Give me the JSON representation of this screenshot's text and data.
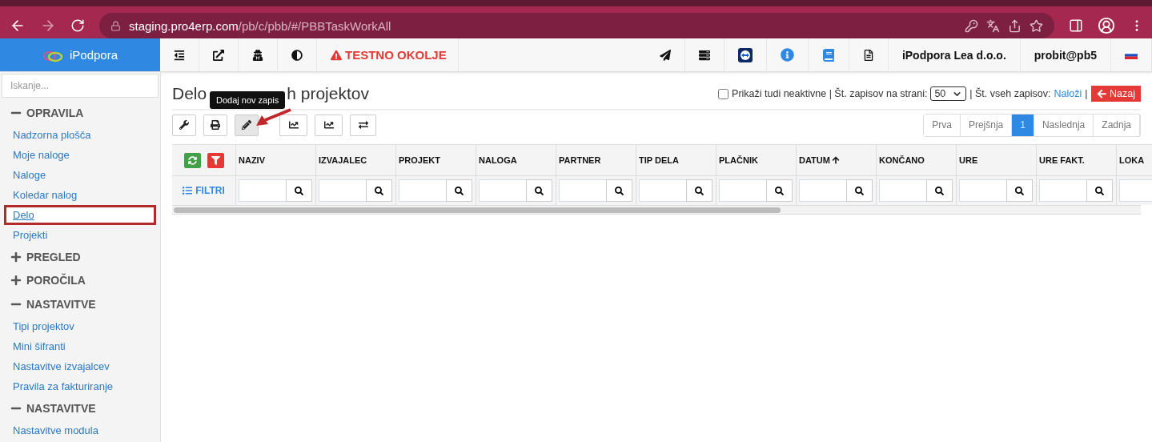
{
  "browser": {
    "url_host": "staging.pro4erp.com",
    "url_path": "/pb/c/pbb/#/PBBTaskWorkAll"
  },
  "header": {
    "brand": "iPodpora",
    "warning": "TESTNO OKOLJE",
    "company": "iPodpora Lea d.o.o.",
    "user": "probit@pb5"
  },
  "sidebar": {
    "search": {
      "placeholder": "Iskanje..."
    },
    "sections": [
      {
        "title": "OPRAVILA",
        "expanded": true,
        "items": [
          {
            "label": "Nadzorna plošča",
            "selected": false
          },
          {
            "label": "Moje naloge",
            "selected": false
          },
          {
            "label": "Naloge",
            "selected": false
          },
          {
            "label": "Koledar nalog",
            "selected": false
          },
          {
            "label": "Delo",
            "selected": true
          },
          {
            "label": "Projekti",
            "selected": false
          }
        ]
      },
      {
        "title": "PREGLED",
        "expanded": false
      },
      {
        "title": "POROČILA",
        "expanded": false
      },
      {
        "title": "NASTAVITVE",
        "expanded": true,
        "items": [
          {
            "label": "Tipi projektov",
            "selected": false
          },
          {
            "label": "Mini šifranti",
            "selected": false
          },
          {
            "label": "Nastavitve izvajalcev",
            "selected": false
          },
          {
            "label": "Pravila za fakturiranje",
            "selected": false
          }
        ]
      },
      {
        "title": "NASTAVITVE",
        "expanded": true,
        "items": [
          {
            "label": "Nastavitve modula",
            "selected": false
          }
        ]
      }
    ]
  },
  "page": {
    "title_parts": [
      "Delo",
      "h projektov"
    ],
    "tooltip": "Dodaj nov zapis",
    "options": {
      "show_inactive_label": "Prikaži tudi neaktivne | Št. zapisov na strani:",
      "show_inactive": false,
      "page_size": "50",
      "total_label": "| Št. vseh zapisov:",
      "load_link": "Naloži",
      "separator": "|",
      "back_button": "Nazaj"
    },
    "tools": [
      {
        "kind": "settings",
        "pressed": false
      },
      {
        "kind": "print",
        "pressed": false
      },
      {
        "kind": "edit",
        "pressed": true
      },
      {
        "kind": "chart",
        "pressed": false
      },
      {
        "kind": "chart",
        "pressed": false
      },
      {
        "kind": "swap",
        "pressed": false
      }
    ],
    "pagination": [
      {
        "label": "Prva",
        "selected": false
      },
      {
        "label": "Prejšnja",
        "selected": false
      },
      {
        "label": "1",
        "selected": true
      },
      {
        "label": "Naslednja",
        "selected": false
      },
      {
        "label": "Zadnja",
        "selected": false
      }
    ],
    "filters_label": "FILTRI",
    "columns": [
      {
        "label": "NAZIV",
        "sorted": false
      },
      {
        "label": "IZVAJALEC",
        "sorted": false
      },
      {
        "label": "PROJEKT",
        "sorted": false
      },
      {
        "label": "NALOGA",
        "sorted": false
      },
      {
        "label": "PARTNER",
        "sorted": false
      },
      {
        "label": "TIP DELA",
        "sorted": false
      },
      {
        "label": "PLAČNIK",
        "sorted": false
      },
      {
        "label": "DATUM",
        "sorted": true
      },
      {
        "label": "KONČANO",
        "sorted": false
      },
      {
        "label": "URE",
        "sorted": false
      },
      {
        "label": "URE FAKT.",
        "sorted": false
      },
      {
        "label": "LOKA",
        "sorted": false
      }
    ]
  }
}
